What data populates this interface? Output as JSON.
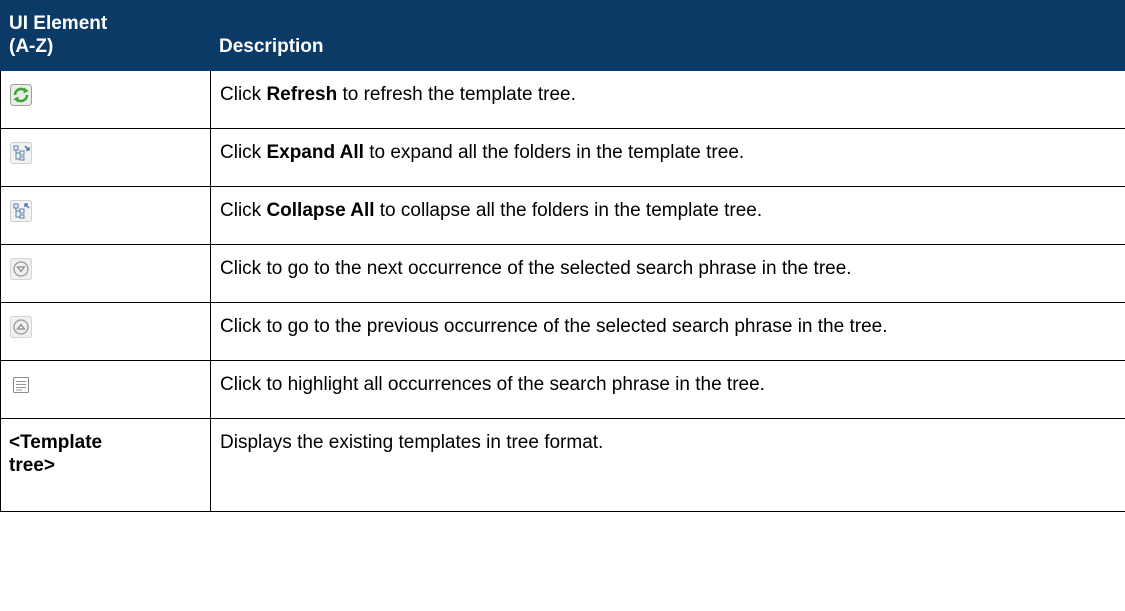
{
  "header": {
    "col1": "UI Element (A-Z)",
    "col1_line1": "UI Element",
    "col1_line2": "(A-Z)",
    "col2": "Description"
  },
  "rows": [
    {
      "icon": "refresh-icon",
      "desc_prefix": "Click ",
      "desc_bold": "Refresh",
      "desc_suffix": " to refresh the template tree."
    },
    {
      "icon": "expand-all-icon",
      "desc_prefix": "Click ",
      "desc_bold": "Expand All",
      "desc_suffix": " to expand all the folders in the template tree."
    },
    {
      "icon": "collapse-all-icon",
      "desc_prefix": "Click ",
      "desc_bold": "Collapse All",
      "desc_suffix": " to collapse all the folders in the template tree."
    },
    {
      "icon": "next-occurrence-icon",
      "desc": "Click to go to the next occurrence of the selected search phrase in the tree."
    },
    {
      "icon": "previous-occurrence-icon",
      "desc": "Click to go to the previous occurrence of the selected search phrase in the tree."
    },
    {
      "icon": "highlight-all-icon",
      "desc": "Click to highlight all occurrences of the search phrase in the tree."
    },
    {
      "element_label": "<Template tree>",
      "element_line1": "<Template",
      "element_line2": "tree>",
      "desc": "Displays the existing templates in tree format."
    }
  ],
  "colors": {
    "header_bg": "#0b3a66",
    "header_text": "#ffffff",
    "border": "#000000",
    "refresh_green": "#3fa33a"
  }
}
